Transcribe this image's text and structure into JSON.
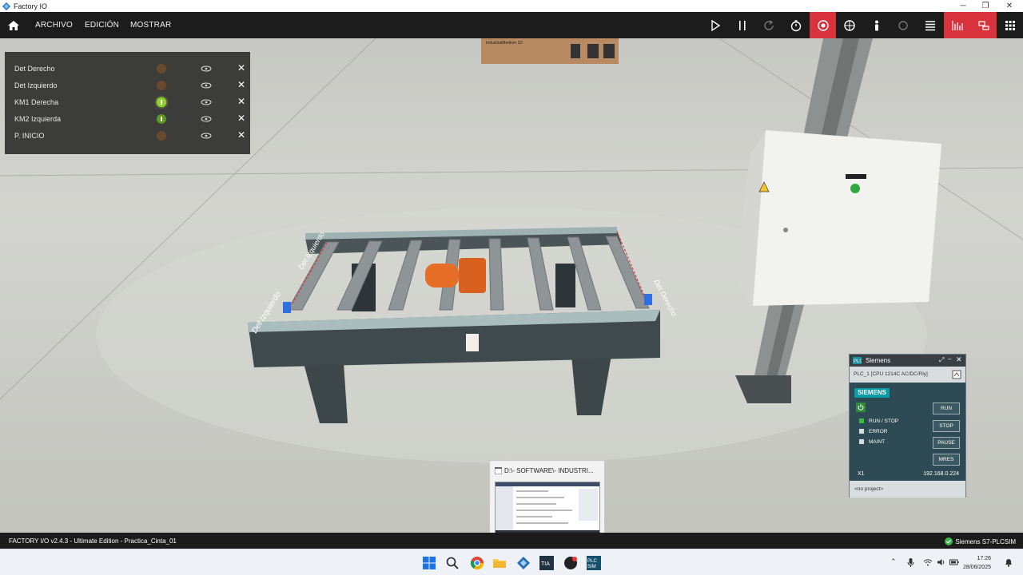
{
  "window": {
    "title": "Factory IO"
  },
  "menu": {
    "items": [
      "ARCHIVO",
      "EDICIÓN",
      "MOSTRAR"
    ]
  },
  "toolbar": {
    "icons": [
      "play-icon",
      "pause-icon",
      "reset-icon",
      "timer-icon",
      "camera-orbit-icon",
      "camera-fly-icon",
      "camera-first-person-icon",
      "light-icon",
      "sensor-view-icon",
      "tag-list-icon",
      "chart-icon",
      "drivers-icon",
      "apps-grid-icon"
    ]
  },
  "tags": [
    {
      "name": "Det Derecho",
      "state": "off"
    },
    {
      "name": "Det Izquierdo",
      "state": "off"
    },
    {
      "name": "KM1 Derecha",
      "state": "on"
    },
    {
      "name": "KM2 Izquierda",
      "state": "dim"
    },
    {
      "name": "P. INICIO",
      "state": "off"
    }
  ],
  "scene": {
    "box_label": "IndustrialMedium 1D",
    "sensor_left": "Det Izquierdo",
    "sensor_top": "Det Izquierdo",
    "sensor_right": "Det Derecho"
  },
  "plc": {
    "title": "Siemens",
    "cpu": "PLC_1 [CPU 1214C AC/DC/Rly]",
    "brand": "SIEMENS",
    "buttons": [
      "RUN",
      "STOP",
      "PAUSE",
      "MRES"
    ],
    "statuses": [
      "RUN / STOP",
      "ERROR",
      "MAINT"
    ],
    "x1": "X1",
    "ip": "192.168.0.224",
    "project": "<no project>"
  },
  "thumbnail": {
    "title": "D:\\- SOFTWARE\\- INDUSTRI..."
  },
  "status": {
    "left": "FACTORY I/O v2.4.3 - Ultimate Edition - Practica_Cinta_01",
    "right": "Siemens S7-PLCSIM"
  },
  "clock": {
    "time": "17:26",
    "date": "28/06/2025"
  }
}
